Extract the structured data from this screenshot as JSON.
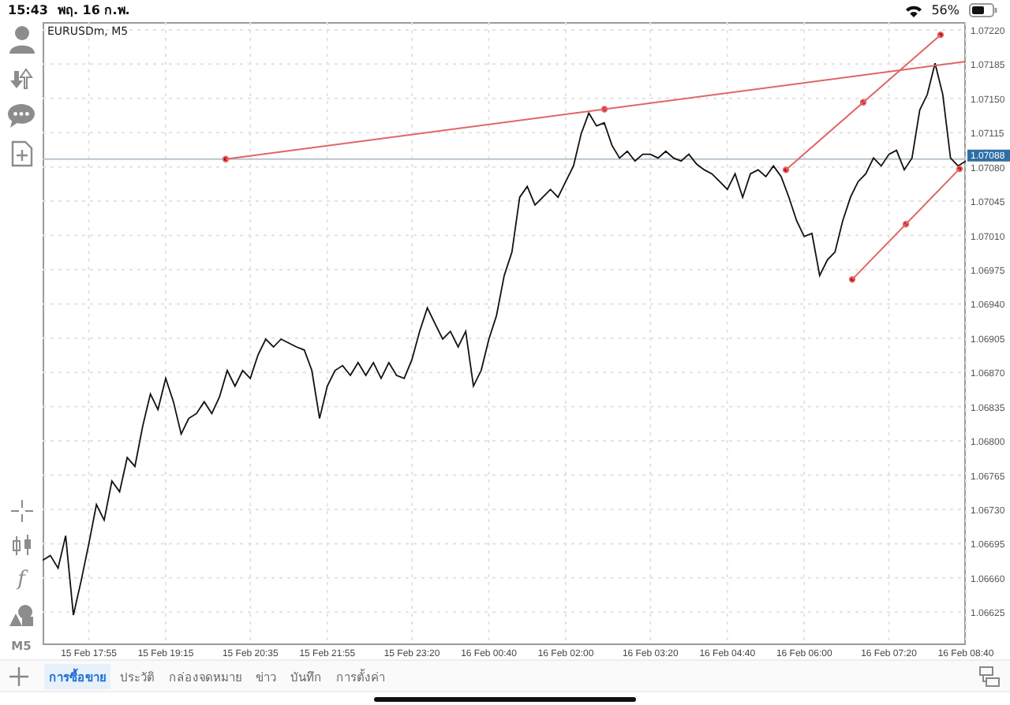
{
  "status_bar": {
    "time": "15:43",
    "date": "พฤ. 16 ก.พ.",
    "battery": "56%"
  },
  "toolbar": {
    "function_label": "f",
    "timeframe": "M5"
  },
  "chart": {
    "chart_data": {
      "type": "line",
      "title": "EURUSDm, M5",
      "categories": [
        null,
        null,
        null,
        null,
        null,
        null,
        "15 Feb 17:55",
        null,
        null,
        null,
        null,
        null,
        null,
        null,
        null,
        null,
        "15 Feb 19:15",
        null,
        null,
        null,
        null,
        null,
        null,
        null,
        null,
        null,
        null,
        "15 Feb 20:35",
        null,
        null,
        null,
        null,
        null,
        null,
        null,
        null,
        null,
        "15 Feb 21:55",
        null,
        null,
        null,
        null,
        null,
        null,
        null,
        null,
        null,
        null,
        "15 Feb 23:20",
        null,
        null,
        null,
        null,
        null,
        null,
        null,
        null,
        null,
        "16 Feb 00:40",
        null,
        null,
        null,
        null,
        null,
        null,
        null,
        null,
        null,
        "16 Feb 02:00",
        null,
        null,
        null,
        null,
        null,
        null,
        null,
        null,
        null,
        null,
        "16 Feb 03:20",
        null,
        null,
        null,
        null,
        null,
        null,
        null,
        null,
        null,
        "16 Feb 04:40",
        null,
        null,
        null,
        null,
        null,
        null,
        null,
        null,
        null,
        "16 Feb 06:00",
        null,
        null,
        null,
        null,
        null,
        null,
        null,
        null,
        null,
        null,
        "16 Feb 07:20",
        null,
        null,
        null,
        null,
        null,
        null,
        null,
        null,
        null,
        "16 Feb 08:40"
      ],
      "series": [
        {
          "color": "#111111",
          "values": [
            1.06678,
            1.06683,
            1.0667,
            1.06703,
            1.06622,
            1.06657,
            1.06695,
            1.06735,
            1.06719,
            1.06759,
            1.06748,
            1.06783,
            1.06774,
            1.06815,
            1.06848,
            1.06832,
            1.06864,
            1.0684,
            1.06807,
            1.06823,
            1.06828,
            1.0684,
            1.06828,
            1.06845,
            1.06872,
            1.06856,
            1.06872,
            1.06864,
            1.06888,
            1.06904,
            1.06896,
            1.06904,
            1.069,
            1.06896,
            1.06893,
            1.06872,
            1.06823,
            1.06856,
            1.06872,
            1.06877,
            1.06867,
            1.0688,
            1.06867,
            1.0688,
            1.06864,
            1.0688,
            1.06867,
            1.06864,
            1.06883,
            1.06912,
            1.06936,
            1.0692,
            1.06904,
            1.06912,
            1.06896,
            1.06912,
            1.06856,
            1.06872,
            1.06904,
            1.06928,
            1.06969,
            1.06993,
            1.07049,
            1.0706,
            1.07041,
            1.07049,
            1.07057,
            1.07049,
            1.07065,
            1.07081,
            1.07114,
            1.07135,
            1.07122,
            1.07125,
            1.07102,
            1.07089,
            1.07096,
            1.07086,
            1.07093,
            1.07093,
            1.07089,
            1.07096,
            1.07089,
            1.07086,
            1.07093,
            1.07083,
            1.07077,
            1.07073,
            1.07065,
            1.07057,
            1.07073,
            1.07049,
            1.07073,
            1.07077,
            1.0707,
            1.07081,
            1.0707,
            1.07049,
            1.07025,
            1.07009,
            1.07012,
            1.06969,
            1.06985,
            1.06993,
            1.07025,
            1.07049,
            1.07065,
            1.07073,
            1.07089,
            1.07081,
            1.07093,
            1.07097,
            1.07077,
            1.07089,
            1.07138,
            1.07154,
            1.07186,
            1.07154,
            1.07089,
            1.07081,
            1.07086
          ]
        }
      ],
      "ylim": [
        1.06593,
        1.07228
      ],
      "grid": true,
      "ref_lines": [
        {
          "axis": "y",
          "value": 1.07088,
          "label": "1.07088"
        }
      ],
      "yticks": [
        {
          "value": 1.0722,
          "label": "1.07220"
        },
        {
          "value": 1.07185,
          "label": "1.07185"
        },
        {
          "value": 1.0715,
          "label": "1.07150"
        },
        {
          "value": 1.07115,
          "label": "1.07115"
        },
        {
          "value": 1.0708,
          "label": "1.07080"
        },
        {
          "value": 1.07045,
          "label": "1.07045"
        },
        {
          "value": 1.0701,
          "label": "1.07010"
        },
        {
          "value": 1.06975,
          "label": "1.06975"
        },
        {
          "value": 1.0694,
          "label": "1.06940"
        },
        {
          "value": 1.06905,
          "label": "1.06905"
        },
        {
          "value": 1.0687,
          "label": "1.06870"
        },
        {
          "value": 1.06835,
          "label": "1.06835"
        },
        {
          "value": 1.068,
          "label": "1.06800"
        },
        {
          "value": 1.06765,
          "label": "1.06765"
        },
        {
          "value": 1.0673,
          "label": "1.06730"
        },
        {
          "value": 1.06695,
          "label": "1.06695"
        },
        {
          "value": 1.0666,
          "label": "1.06660"
        },
        {
          "value": 1.06625,
          "label": "1.06625"
        }
      ]
    }
  },
  "tabs": [
    {
      "label": "การซื้อขาย",
      "selected": true
    },
    {
      "label": "ประวัติ",
      "selected": false
    },
    {
      "label": "กล่องจดหมาย",
      "selected": false
    },
    {
      "label": "ข่าว",
      "selected": false
    },
    {
      "label": "บันทึก",
      "selected": false
    },
    {
      "label": "การตั้งค่า",
      "selected": false
    }
  ]
}
